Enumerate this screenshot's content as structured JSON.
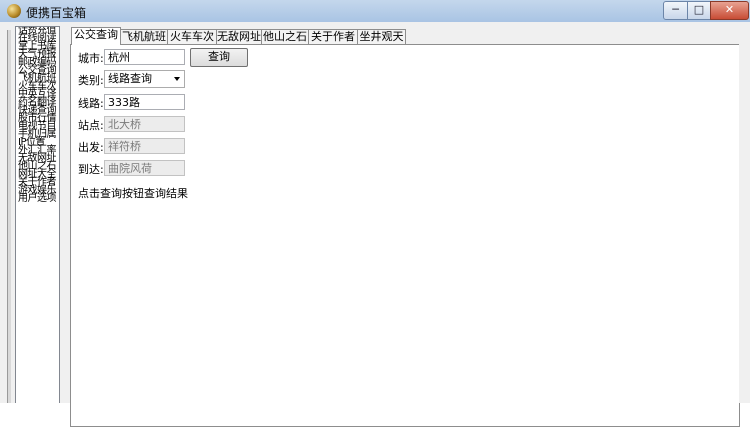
{
  "window": {
    "title": "便携百宝箱",
    "min_glyph": "─",
    "max_glyph": "□",
    "close_glyph": "✕"
  },
  "sidebar": {
    "items": [
      "话费充值",
      "在线阅读",
      "掌上书库",
      "天气预报",
      "邮政编码",
      "公交查询",
      "飞机航班",
      "火车车次",
      "中英互译",
      "药名翻译",
      "快递查询",
      "股市行情",
      "电视节目",
      "手机归属",
      "IP位置",
      "外汇汇率",
      "无敌网址",
      "他山之石",
      "网址大全",
      "关于作者",
      "游戏娱乐",
      "用户选项"
    ]
  },
  "tabs": [
    "公交查询",
    "飞机航班",
    "火车车次",
    "无敌网址",
    "他山之石",
    "关于作者",
    "坐井观天"
  ],
  "form": {
    "city_label": "城市:",
    "city_value": "杭州",
    "query_button": "查询",
    "category_label": "类别:",
    "category_value": "线路查询",
    "route_label": "线路:",
    "route_value": "333路",
    "station_label": "站点:",
    "station_value": "北大桥",
    "depart_label": "出发:",
    "depart_value": "祥符桥",
    "arrive_label": "到达:",
    "arrive_value": "曲院风荷",
    "hint": "点击查询按钮查询结果"
  }
}
